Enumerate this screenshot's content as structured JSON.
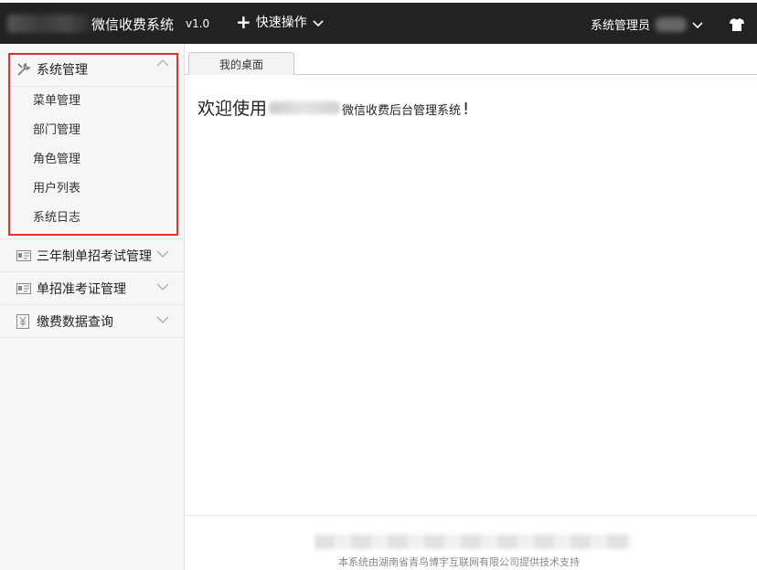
{
  "header": {
    "app_title": "微信收费系统",
    "version": "v1.0",
    "quick_ops_label": "快速操作",
    "admin_label": "系统管理员"
  },
  "sidebar": {
    "groups": [
      {
        "label": "系统管理",
        "icon": "wrench-icon",
        "expanded": true,
        "items": [
          "菜单管理",
          "部门管理",
          "角色管理",
          "用户列表",
          "系统日志"
        ]
      },
      {
        "label": "三年制单招考试管理",
        "icon": "id-card-icon",
        "expanded": false
      },
      {
        "label": "单招准考证管理",
        "icon": "id-card-icon",
        "expanded": false
      },
      {
        "label": "缴费数据查询",
        "icon": "money-doc-icon",
        "expanded": false
      }
    ]
  },
  "tabs": [
    {
      "label": "我的桌面",
      "active": true
    }
  ],
  "main": {
    "welcome_prefix": "欢迎使用",
    "welcome_suffix": "微信收费后台管理系统",
    "welcome_excl": "!"
  },
  "footer": {
    "support_text": "本系统由湖南省青鸟博宇互联网有限公司提供技术支持"
  },
  "colors": {
    "header_bg": "#222222",
    "highlight_border": "#e03030",
    "sidebar_bg": "#f6f6f6"
  }
}
